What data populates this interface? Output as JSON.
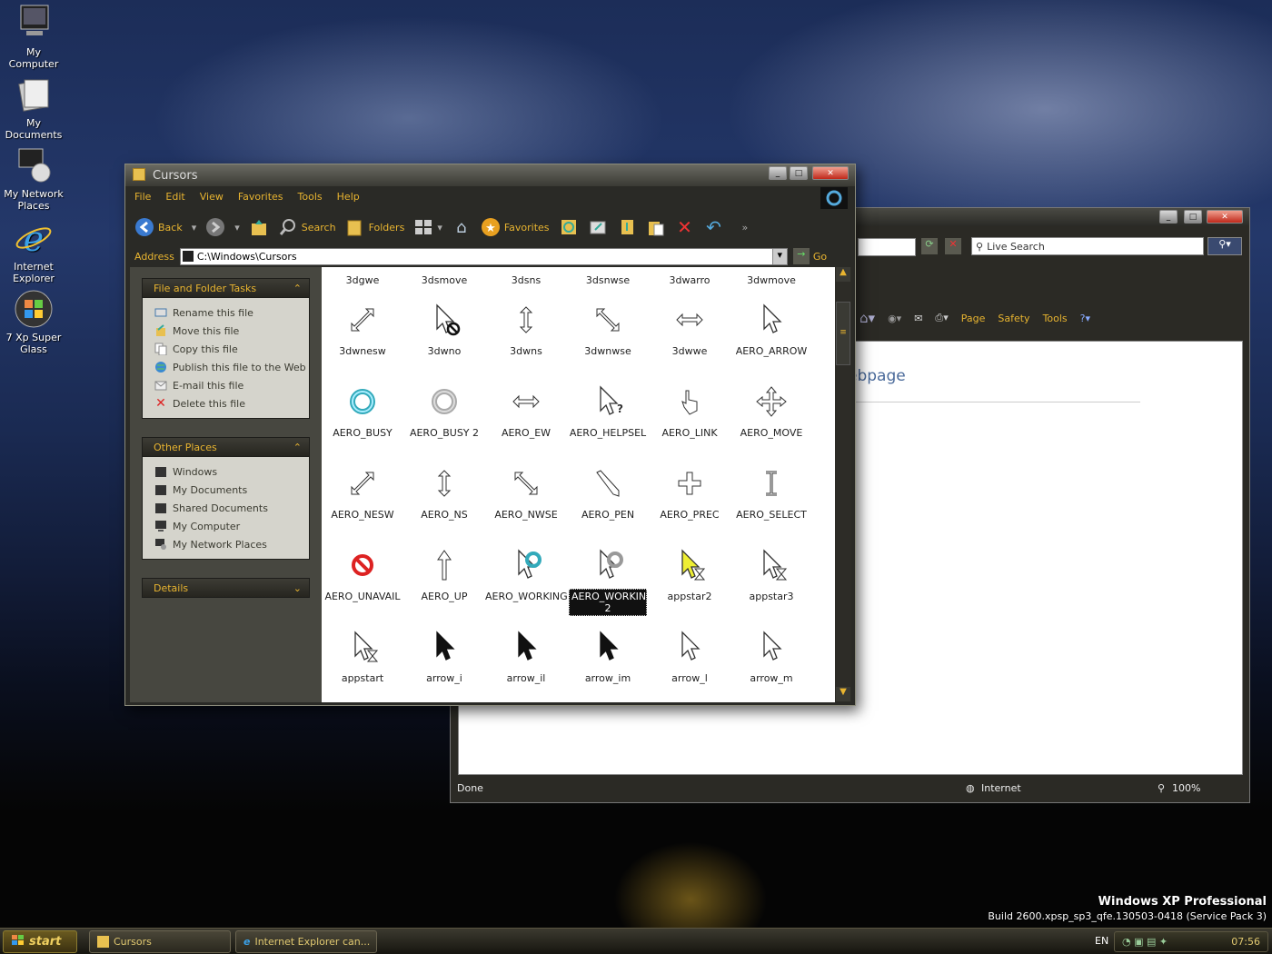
{
  "desktop": {
    "icons": [
      {
        "label": "My Computer",
        "icon": "computer-icon"
      },
      {
        "label": "My Documents",
        "icon": "documents-icon"
      },
      {
        "label": "My Network Places",
        "icon": "network-icon"
      },
      {
        "label": "Internet Explorer",
        "icon": "ie-icon"
      },
      {
        "label": "7 Xp Super Glass",
        "icon": "windows-logo-icon"
      }
    ],
    "watermark_title": "Windows XP Professional",
    "watermark_build": "Build 2600.xpsp_sp3_qfe.130503-0418 (Service Pack 3)"
  },
  "ie": {
    "search_placeholder": "Live Search",
    "commands": [
      "Page",
      "Safety",
      "Tools"
    ],
    "page_text_partial": "ebpage",
    "status": "Done",
    "zone": "Internet",
    "zoom": "100%"
  },
  "explorer": {
    "title": "Cursors",
    "menu": [
      "File",
      "Edit",
      "View",
      "Favorites",
      "Tools",
      "Help"
    ],
    "toolbar": {
      "back": "Back",
      "search": "Search",
      "folders": "Folders",
      "favorites": "Favorites"
    },
    "address_label": "Address",
    "address_value": "C:\\Windows\\Cursors",
    "go": "Go",
    "file_tasks": {
      "title": "File and Folder Tasks",
      "items": [
        "Rename this file",
        "Move this file",
        "Copy this file",
        "Publish this file to the Web",
        "E-mail this file",
        "Delete this file"
      ]
    },
    "other_places": {
      "title": "Other Places",
      "items": [
        "Windows",
        "My Documents",
        "Shared Documents",
        "My Computer",
        "My Network Places"
      ]
    },
    "details": {
      "title": "Details"
    },
    "top_names": [
      "3dgwe",
      "3dsmove",
      "3dsns",
      "3dsnwse",
      "3dwarro",
      "3dwmove"
    ],
    "files": [
      [
        "3dwnesw",
        "3dwno",
        "3dwns",
        "3dwnwse",
        "3dwwe",
        "AERO_ARROW"
      ],
      [
        "AERO_BUSY",
        "AERO_BUSY 2",
        "AERO_EW",
        "AERO_HELPSEL",
        "AERO_LINK",
        "AERO_MOVE"
      ],
      [
        "AERO_NESW",
        "AERO_NS",
        "AERO_NWSE",
        "AERO_PEN",
        "AERO_PREC",
        "AERO_SELECT"
      ],
      [
        "AERO_UNAVAIL",
        "AERO_UP",
        "AERO_WORKING",
        "AERO_WORKING 2",
        "appstar2",
        "appstar3"
      ],
      [
        "appstart",
        "arrow_i",
        "arrow_il",
        "arrow_im",
        "arrow_l",
        "arrow_m"
      ]
    ]
  },
  "taskbar": {
    "start": "start",
    "buttons": [
      "Cursors",
      "Internet Explorer can..."
    ],
    "lang": "EN",
    "clock": "07:56"
  }
}
